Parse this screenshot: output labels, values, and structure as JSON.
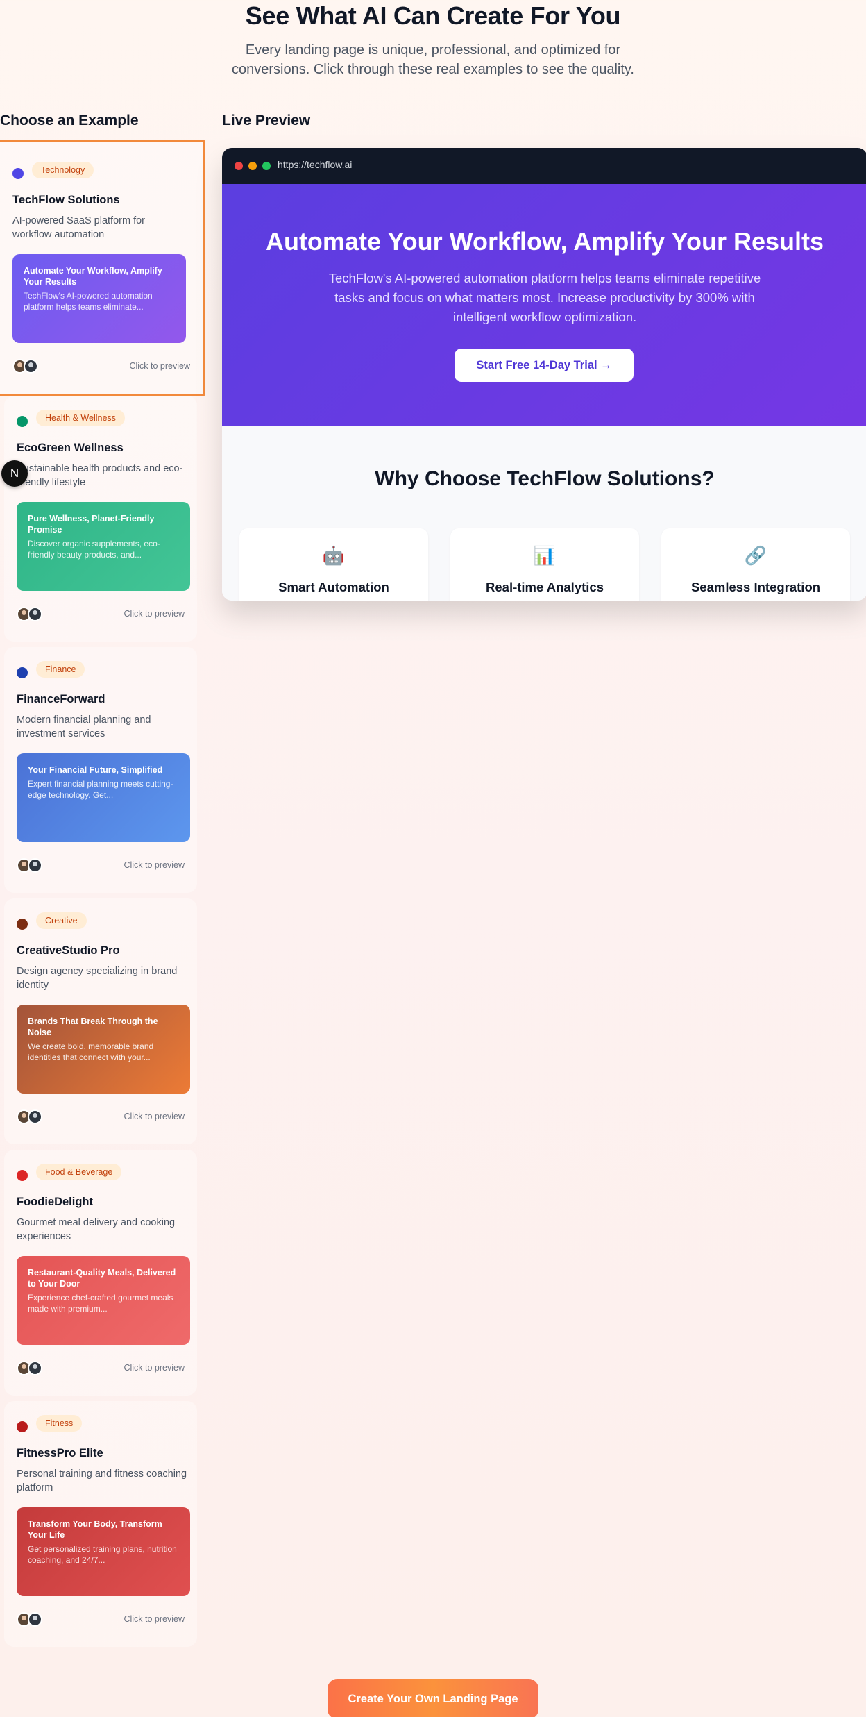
{
  "header": {
    "title": "See What AI Can Create For You",
    "subtitle": "Every landing page is unique, professional, and optimized for conversions. Click through these real examples to see the quality."
  },
  "examples_heading": "Choose an Example",
  "preview_heading": "Live Preview",
  "examples": [
    {
      "tag": "Technology",
      "dot_color": "#4f46e5",
      "title": "TechFlow Solutions",
      "description": "AI-powered SaaS platform for workflow automation",
      "thumb_title": "Automate Your Workflow, Amplify Your Results",
      "thumb_text": "TechFlow's AI-powered automation platform helps teams eliminate...",
      "thumb_colors": [
        "#6d5cf0",
        "#9358ec"
      ],
      "hint": "Click to preview",
      "selected": true
    },
    {
      "tag": "Health & Wellness",
      "dot_color": "#059669",
      "title": "EcoGreen Wellness",
      "description": "Sustainable health products and eco-friendly lifestyle",
      "thumb_title": "Pure Wellness, Planet-Friendly Promise",
      "thumb_text": "Discover organic supplements, eco-friendly beauty products, and...",
      "thumb_colors": [
        "#2fb588",
        "#43c596"
      ],
      "hint": "Click to preview",
      "selected": false
    },
    {
      "tag": "Finance",
      "dot_color": "#1e40af",
      "title": "FinanceForward",
      "description": "Modern financial planning and investment services",
      "thumb_title": "Your Financial Future, Simplified",
      "thumb_text": "Expert financial planning meets cutting-edge technology. Get...",
      "thumb_colors": [
        "#4b72d6",
        "#5d97ee"
      ],
      "hint": "Click to preview",
      "selected": false
    },
    {
      "tag": "Creative",
      "dot_color": "#7c2d12",
      "title": "CreativeStudio Pro",
      "description": "Design agency specializing in brand identity",
      "thumb_title": "Brands That Break Through the Noise",
      "thumb_text": "We create bold, memorable brand identities that connect with your...",
      "thumb_colors": [
        "#a3543a",
        "#ec7b36"
      ],
      "hint": "Click to preview",
      "selected": false
    },
    {
      "tag": "Food & Beverage",
      "dot_color": "#dc2626",
      "title": "FoodieDelight",
      "description": "Gourmet meal delivery and cooking experiences",
      "thumb_title": "Restaurant-Quality Meals, Delivered to Your Door",
      "thumb_text": "Experience chef-crafted gourmet meals made with premium...",
      "thumb_colors": [
        "#e45555",
        "#ef6a6a"
      ],
      "hint": "Click to preview",
      "selected": false
    },
    {
      "tag": "Fitness",
      "dot_color": "#b91c1c",
      "title": "FitnessPro Elite",
      "description": "Personal training and fitness coaching platform",
      "thumb_title": "Transform Your Body, Transform Your Life",
      "thumb_text": "Get personalized training plans, nutrition coaching, and 24/7...",
      "thumb_colors": [
        "#c43b3b",
        "#e05050"
      ],
      "hint": "Click to preview",
      "selected": false
    }
  ],
  "floating_badge": "N",
  "preview": {
    "url": "https://techflow.ai",
    "hero_title": "Automate Your Workflow, Amplify Your Results",
    "hero_text": "TechFlow's AI-powered automation platform helps teams eliminate repetitive tasks and focus on what matters most. Increase productivity by 300% with intelligent workflow optimization.",
    "cta": "Start Free 14-Day Trial →",
    "why_title": "Why Choose TechFlow Solutions?",
    "features": [
      {
        "icon": "🤖",
        "icon_name": "robot-icon",
        "title": "Smart Automation"
      },
      {
        "icon": "📊",
        "icon_name": "bar-chart-icon",
        "title": "Real-time Analytics"
      },
      {
        "icon": "🔗",
        "icon_name": "link-icon",
        "title": "Seamless Integration"
      }
    ],
    "colors": {
      "hero_start": "#5b3ee0",
      "hero_end": "#7537e4"
    }
  },
  "bottom_cta": "Create Your Own Landing Page"
}
